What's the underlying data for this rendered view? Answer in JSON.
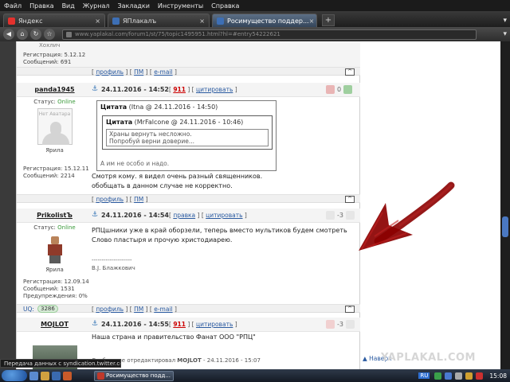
{
  "browser": {
    "menu": [
      "Файл",
      "Правка",
      "Вид",
      "Журнал",
      "Закладки",
      "Инструменты",
      "Справка"
    ],
    "tabs": [
      {
        "label": "Яндекс",
        "favicon_color": "#e3312d",
        "active": false
      },
      {
        "label": "ЯПлакалъ",
        "favicon_color": "#3d6fb5",
        "active": false
      },
      {
        "label": "Росимущество поддер...",
        "favicon_color": "#3d6fb5",
        "active": true
      }
    ],
    "url": "www.yaplakal.com/forum1/st/75/topic1495951.html?hl=#entry54222621"
  },
  "previous_post": {
    "nick_partial": "Хохлич",
    "reg_label": "Регистрация: 5.12.12",
    "msgs_label": "Сообщений: 691"
  },
  "footer_links": {
    "profile": "профиль",
    "pm": "ПМ",
    "email": "e-mail",
    "up": "[^]"
  },
  "posts": [
    {
      "nick": "panda1945",
      "date": "24.11.2016 - 14:52",
      "count": "911",
      "quote_label": "цитировать",
      "rating": "0",
      "status_label": "Статус:",
      "status": "Online",
      "avatar_text": "Нет Аватара",
      "rank": "Ярила",
      "reg": "Регистрация: 15.12.11",
      "msgs": "Сообщений: 2214",
      "outer_quote": {
        "header_prefix": "Цитата",
        "header_meta": "(Itna @ 24.11.2016 - 14:50)",
        "inner_header_prefix": "Цитата",
        "inner_header_meta": "(MrFalcone @ 24.11.2016 - 10:46)",
        "inner_lines": [
          "Храны вернуть несложно.",
          "Попробуй верни доверие..."
        ],
        "tail": "А им не особо и надо."
      },
      "text_lines": [
        "Смотря кому. я видел очень разный священников.",
        "обобщать в данном случае не корректно."
      ]
    },
    {
      "nick": "PrikolistЪ",
      "date": "24.11.2016 - 14:54",
      "edit_label": "правка",
      "quote_label": "цитировать",
      "rating": "-3",
      "status_label": "Статус:",
      "status": "Online",
      "rank": "Ярила",
      "reg": "Регистрация: 12.09.14",
      "msgs": "Сообщений: 1531",
      "warn": "Предупреждения: 0%",
      "text_lines": [
        "РПЦшники уже в край оборзели, теперь вместо мультиков будем смотреть",
        "Слово пластыря и прочую христодиарею."
      ],
      "signature_rule": "--------------------",
      "signature": "В.J. Блажкович",
      "uq_label": "UQ:",
      "uq_value": "3286"
    },
    {
      "nick": "MOJLOT",
      "date": "24.11.2016 - 14:55",
      "count": "911",
      "quote_label": "цитировать",
      "rating": "-3",
      "text_lines": [
        "Наша страна и правительство Фанат ООО \"РПЦ\""
      ],
      "edit_note_prefix": "Сообщение отредактировал",
      "edit_note_user": "MOJLOT",
      "edit_note_date": "- 24.11.2016 - 15:07"
    }
  ],
  "watermark": "YAPLAKAL.COM",
  "back_link": "▲ Наверх",
  "status_bar": "Передача данных с syndication.twitter.com...",
  "taskbar": {
    "task": "Росимущество подд...",
    "lang": "RU",
    "clock": "15:08"
  },
  "colors": {
    "accent_blue": "#2a5aa0",
    "online_green": "#3a9a3a",
    "arrow_red": "#8b0000"
  }
}
